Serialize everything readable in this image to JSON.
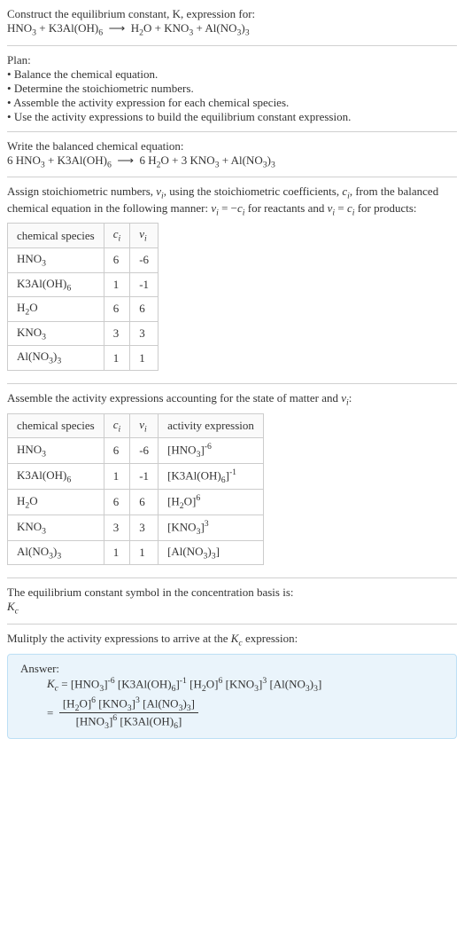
{
  "intro": {
    "line1": "Construct the equilibrium constant, K, expression for:",
    "equation": "HNO₃ + K3Al(OH)₆ ⟶ H₂O + KNO₃ + Al(NO₃)₃"
  },
  "plan": {
    "heading": "Plan:",
    "bullets": [
      "Balance the chemical equation.",
      "Determine the stoichiometric numbers.",
      "Assemble the activity expression for each chemical species.",
      "Use the activity expressions to build the equilibrium constant expression."
    ]
  },
  "balanced": {
    "heading": "Write the balanced chemical equation:",
    "equation": "6 HNO₃ + K3Al(OH)₆ ⟶ 6 H₂O + 3 KNO₃ + Al(NO₃)₃"
  },
  "stoich": {
    "text1": "Assign stoichiometric numbers, νᵢ, using the stoichiometric coefficients, cᵢ, from the balanced chemical equation in the following manner: νᵢ = −cᵢ for reactants and νᵢ = cᵢ for products:",
    "headers": [
      "chemical species",
      "cᵢ",
      "νᵢ"
    ],
    "rows": [
      [
        "HNO₃",
        "6",
        "-6"
      ],
      [
        "K3Al(OH)₆",
        "1",
        "-1"
      ],
      [
        "H₂O",
        "6",
        "6"
      ],
      [
        "KNO₃",
        "3",
        "3"
      ],
      [
        "Al(NO₃)₃",
        "1",
        "1"
      ]
    ]
  },
  "activity": {
    "heading": "Assemble the activity expressions accounting for the state of matter and νᵢ:",
    "headers": [
      "chemical species",
      "cᵢ",
      "νᵢ",
      "activity expression"
    ],
    "rows": [
      [
        "HNO₃",
        "6",
        "-6",
        "[HNO₃]⁻⁶"
      ],
      [
        "K3Al(OH)₆",
        "1",
        "-1",
        "[K3Al(OH)₆]⁻¹"
      ],
      [
        "H₂O",
        "6",
        "6",
        "[H₂O]⁶"
      ],
      [
        "KNO₃",
        "3",
        "3",
        "[KNO₃]³"
      ],
      [
        "Al(NO₃)₃",
        "1",
        "1",
        "[Al(NO₃)₃]"
      ]
    ]
  },
  "symbol": {
    "line1": "The equilibrium constant symbol in the concentration basis is:",
    "line2": "K𞁞"
  },
  "final": {
    "heading": "Mulitply the activity expressions to arrive at the Kc expression:",
    "answer_label": "Answer:",
    "expr_line1": "K𞁞 = [HNO₃]⁻⁶ [K3Al(OH)₆]⁻¹ [H₂O]⁶ [KNO₃]³ [Al(NO₃)₃]",
    "frac_num": "[H₂O]⁶ [KNO₃]³ [Al(NO₃)₃]",
    "frac_den": "[HNO₃]⁶ [K3Al(OH)₆]"
  },
  "chart_data": {
    "type": "table",
    "title": "Stoichiometric numbers",
    "columns": [
      "chemical species",
      "c_i",
      "ν_i"
    ],
    "rows": [
      {
        "species": "HNO3",
        "c_i": 6,
        "nu_i": -6
      },
      {
        "species": "K3Al(OH)6",
        "c_i": 1,
        "nu_i": -1
      },
      {
        "species": "H2O",
        "c_i": 6,
        "nu_i": 6
      },
      {
        "species": "KNO3",
        "c_i": 3,
        "nu_i": 3
      },
      {
        "species": "Al(NO3)3",
        "c_i": 1,
        "nu_i": 1
      }
    ]
  }
}
